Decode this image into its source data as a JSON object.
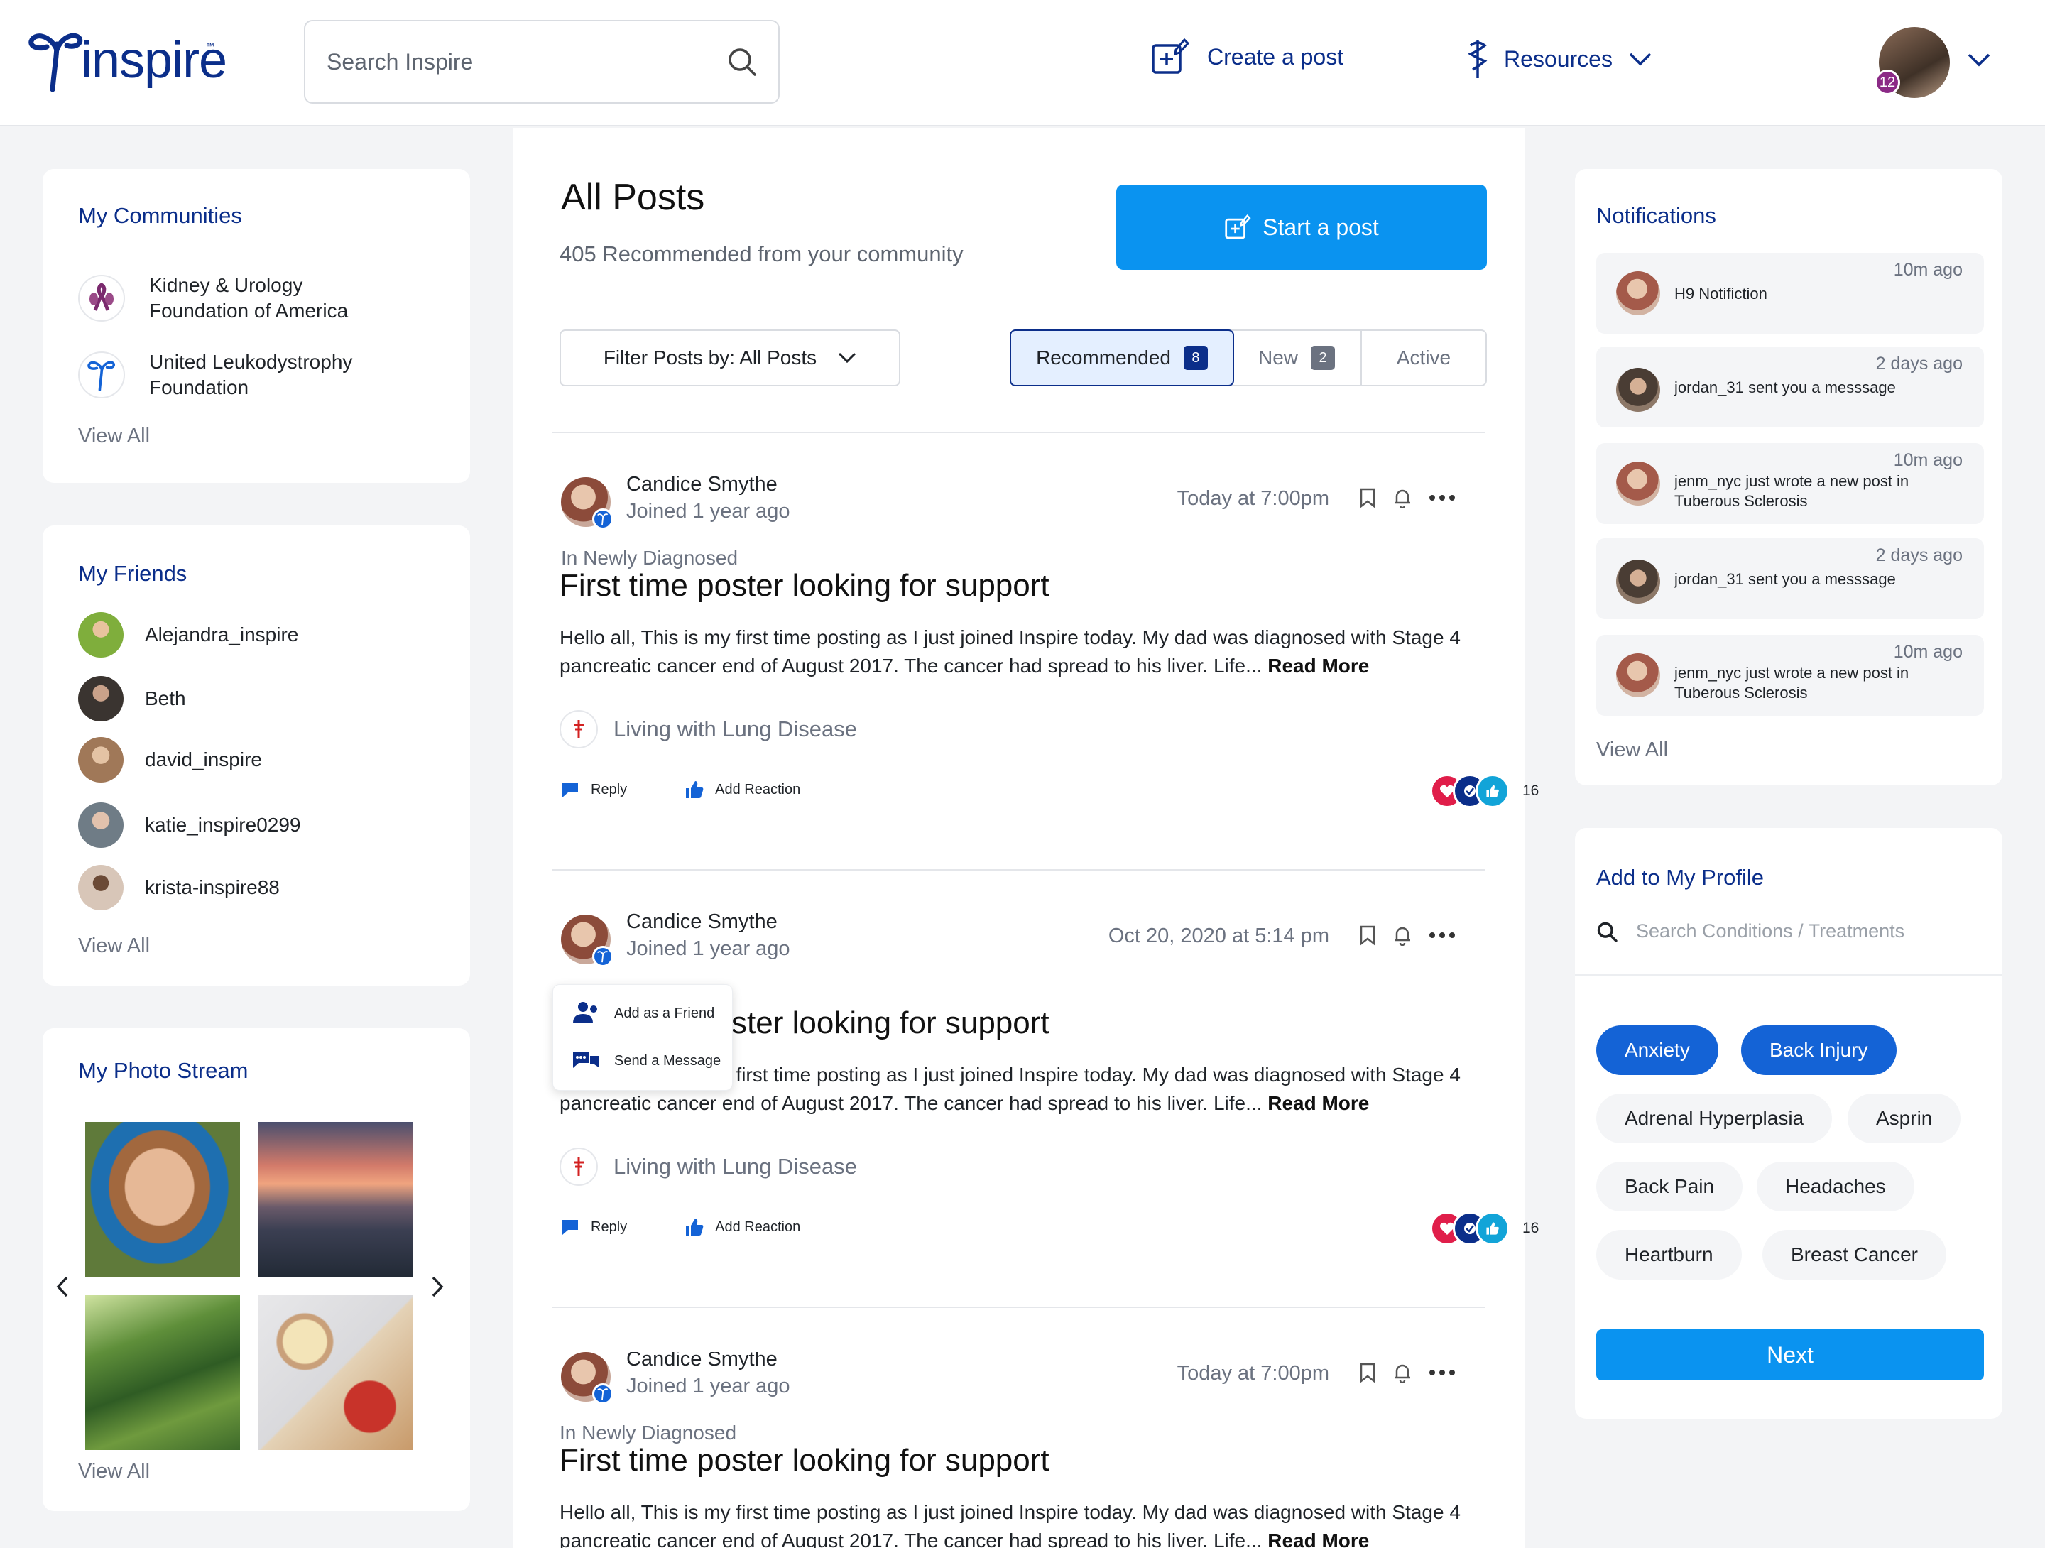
{
  "header": {
    "logo_text": "inspire",
    "logo_tm": "™",
    "search_placeholder": "Search Inspire",
    "create_label": "Create a post",
    "resources_label": "Resources",
    "avatar_badge": "12"
  },
  "communities": {
    "title": "My Communities",
    "items": [
      {
        "name": "Kidney & Urology Foundation of America"
      },
      {
        "name": "United Leukodystrophy Foundation"
      }
    ],
    "view_all": "View All"
  },
  "friends": {
    "title": "My Friends",
    "items": [
      {
        "name": "Alejandra_inspire",
        "color": "#7fae3c"
      },
      {
        "name": "Beth",
        "color": "#3a3430"
      },
      {
        "name": "david_inspire",
        "color": "#a07858"
      },
      {
        "name": "katie_inspire0299",
        "color": "#6f7c86"
      },
      {
        "name": "krista-inspire88",
        "color": "#d8c6b8"
      }
    ],
    "view_all": "View All"
  },
  "photos": {
    "title": "My Photo Stream",
    "view_all": "View All"
  },
  "main": {
    "title": "All Posts",
    "subtitle": "405 Recommended from your community",
    "start_post": "Start a post",
    "filter_label": "Filter Posts by: All Posts",
    "tabs": [
      {
        "label": "Recommended",
        "count": "8"
      },
      {
        "label": "New",
        "count": "2"
      },
      {
        "label": "Active",
        "count": ""
      }
    ],
    "posts": [
      {
        "author": "Candice Smythe",
        "joined": "Joined 1 year ago",
        "time": "Today at 7:00pm",
        "community": "In Newly Diagnosed",
        "title": "First time poster looking for support",
        "body": "Hello all, This is my first time posting as I just joined Inspire today. My dad was diagnosed with Stage 4 pancreatic cancer end of August 2017. The cancer had spread to his liver. Life...",
        "read_more": "Read More",
        "tag": "Living with Lung Disease",
        "reply": "Reply",
        "reaction": "Add Reaction",
        "reaction_count": "16"
      },
      {
        "author": "Candice Smythe",
        "joined": "Joined 1 year ago",
        "time": "Oct 20, 2020 at 5:14 pm",
        "community": "",
        "title": "First time poster looking for support",
        "body": "Hello all, This is my first time posting as I just joined Inspire today. My dad was diagnosed with Stage 4 pancreatic cancer end of August 2017. The cancer had spread to his liver. Life...",
        "read_more": "Read More",
        "tag": "Living with Lung Disease",
        "reply": "Reply",
        "reaction": "Add Reaction",
        "reaction_count": "16"
      },
      {
        "author": "Candice Smythe",
        "joined": "Joined 1 year ago",
        "time": "Today at 7:00pm",
        "community": "In Newly Diagnosed",
        "title": "First time poster looking for support",
        "body": "Hello all, This is my first time posting as I just joined Inspire today. My dad was diagnosed with Stage 4 pancreatic cancer end of August 2017. The cancer had spread to his liver. Life...",
        "read_more": "Read More",
        "tag": "",
        "reply": "",
        "reaction": "",
        "reaction_count": ""
      }
    ],
    "popup": {
      "add_friend": "Add as a Friend",
      "send_message": "Send a Message"
    }
  },
  "notifications": {
    "title": "Notifications",
    "items": [
      {
        "time": "10m ago",
        "text": "H9 Notifiction",
        "avatar_color": "#a45a4a"
      },
      {
        "time": "2 days ago",
        "text": "jordan_31 sent you a messsage",
        "avatar_color": "#4a3d34"
      },
      {
        "time": "10m ago",
        "text": "jenm_nyc just wrote a new post in Tuberous Sclerosis",
        "avatar_color": "#a45a4a"
      },
      {
        "time": "2 days ago",
        "text": "jordan_31 sent you a messsage",
        "avatar_color": "#4a3d34"
      },
      {
        "time": "10m ago",
        "text": "jenm_nyc just wrote a new post in Tuberous Sclerosis",
        "avatar_color": "#a45a4a"
      }
    ],
    "view_all": "View All"
  },
  "profile": {
    "title": "Add to My Profile",
    "search_placeholder": "Search Conditions / Treatments",
    "chips": [
      {
        "label": "Anxiety",
        "selected": true
      },
      {
        "label": "Back Injury",
        "selected": true
      },
      {
        "label": "Adrenal Hyperplasia",
        "selected": false
      },
      {
        "label": "Asprin",
        "selected": false
      },
      {
        "label": "Back Pain",
        "selected": false
      },
      {
        "label": "Headaches",
        "selected": false
      },
      {
        "label": "Heartburn",
        "selected": false
      },
      {
        "label": "Breast Cancer",
        "selected": false
      }
    ],
    "next": "Next"
  },
  "colors": {
    "brand_navy": "#0b2e8a",
    "accent_blue": "#0a93f0",
    "chip_blue": "#1463d6"
  }
}
